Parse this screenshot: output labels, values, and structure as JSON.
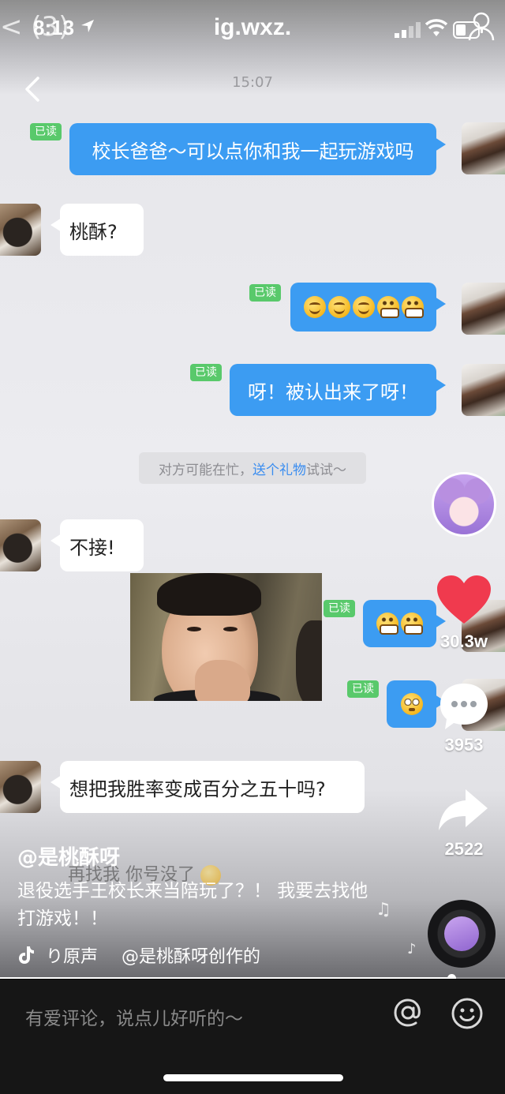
{
  "status_bar": {
    "time": "8:13",
    "back_indicator": "< (3)",
    "title": "ig.wxz."
  },
  "chat": {
    "timestamp": "15:07",
    "read_label": "已读",
    "messages": [
      {
        "from": "me",
        "text": "校长爸爸～可以点你和我一起玩游戏吗"
      },
      {
        "from": "them",
        "text": "桃酥?"
      },
      {
        "from": "me",
        "emojis": [
          "smile-emoji",
          "smile-emoji",
          "smile-emoji",
          "grimace-emoji",
          "grimace-emoji"
        ]
      },
      {
        "from": "me",
        "text": "呀！被认出来了呀！"
      },
      {
        "from": "them",
        "text": "不接!"
      },
      {
        "from": "me",
        "emojis": [
          "grimace-emoji",
          "grimace-emoji"
        ]
      },
      {
        "from": "me",
        "emojis": [
          "flushed-emoji"
        ]
      },
      {
        "from": "them",
        "text": "想把我胜率变成百分之五十吗?"
      }
    ],
    "system_tip": {
      "prefix": "对方可能在忙，",
      "link": "送个礼物",
      "suffix": "试试～"
    },
    "ghost_message": "再找我 你号没了"
  },
  "right_rail": {
    "likes": "30.3w",
    "comments": "3953",
    "shares": "2522"
  },
  "caption": {
    "author": "@是桃酥呀",
    "description": "退役选手王校长来当陪玩了？！ 我要去找他打游戏！！",
    "music_sound": "り原声",
    "music_creator": "@是桃酥呀创作的"
  },
  "progress": {
    "value": 0.894
  },
  "comment_bar": {
    "placeholder": "有爱评论，说点儿好听的～"
  },
  "colors": {
    "bubble_me": "#3c9cf2",
    "read_tag": "#59c96b",
    "like_heart": "#f03a4e",
    "tip_link": "#3a8df0"
  }
}
